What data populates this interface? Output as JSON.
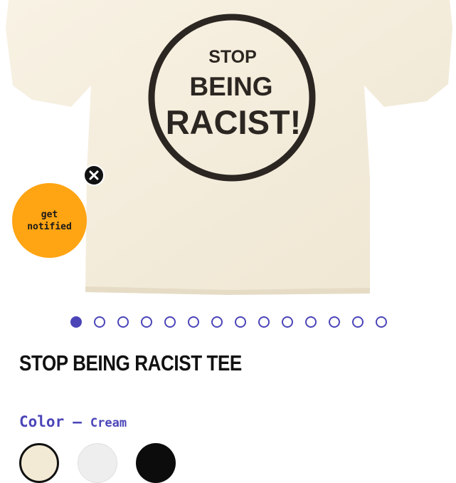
{
  "product": {
    "image": {
      "print_lines": [
        "STOP",
        "BEING",
        "RACIST!"
      ],
      "shirt_color": "#f6efdf",
      "ink_color": "#2b2621"
    },
    "title": "STOP BEING RACIST TEE",
    "color_label": "Color",
    "color_separator": "—",
    "selected_color": "Cream",
    "swatches": [
      {
        "name": "cream",
        "hex": "#f3ead5",
        "selected": true
      },
      {
        "name": "white",
        "hex": "#eeeeee",
        "selected": false
      },
      {
        "name": "black",
        "hex": "#0c0c0c",
        "selected": false
      }
    ]
  },
  "carousel": {
    "total_slides": 14,
    "active_index": 0,
    "accent": "#4b45b8"
  },
  "popup": {
    "notify_label": "get\nnotified",
    "notify_color": "#ffa412",
    "close_icon": "close-icon"
  }
}
